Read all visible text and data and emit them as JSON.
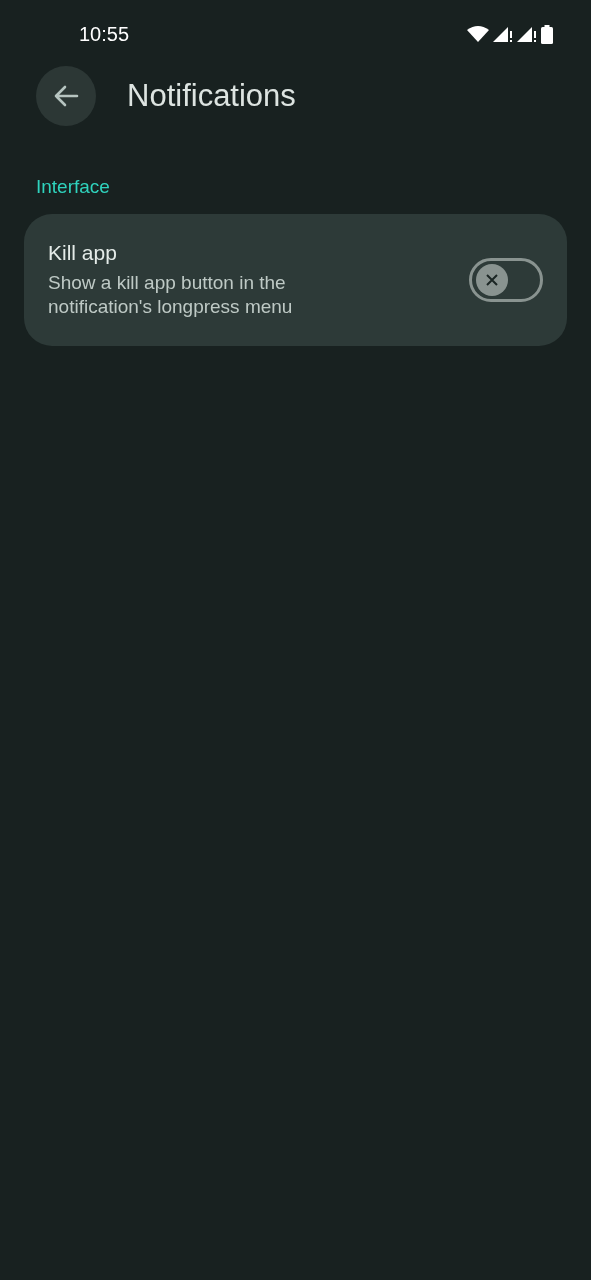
{
  "status_bar": {
    "time": "10:55"
  },
  "app_bar": {
    "title": "Notifications"
  },
  "sections": [
    {
      "header": "Interface",
      "items": [
        {
          "kind": "switch",
          "title": "Kill app",
          "summary": "Show a kill app button in the notification's longpress menu",
          "on": false
        }
      ]
    }
  ]
}
